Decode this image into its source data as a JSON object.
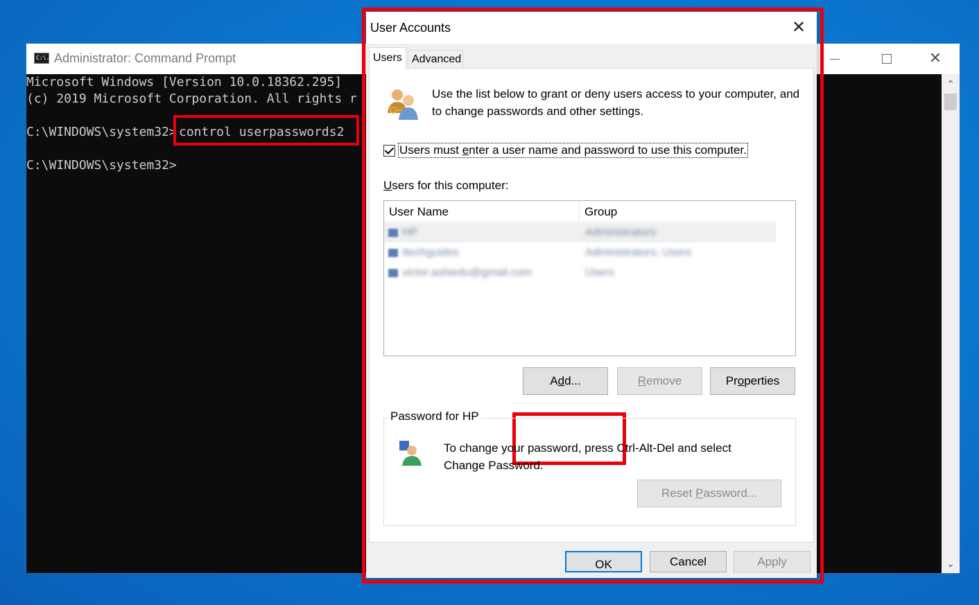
{
  "cmd": {
    "title": "Administrator: Command Prompt",
    "icon_text": "C:\\.",
    "close_glyph": "✕",
    "lines": [
      "Microsoft Windows [Version 10.0.18362.295]",
      "(c) 2019 Microsoft Corporation. All rights r",
      "",
      "C:\\WINDOWS\\system32>",
      "",
      "C:\\WINDOWS\\system32>"
    ],
    "command": "control userpasswords2",
    "scroll_up_glyph": "⌃",
    "scroll_down_glyph": "⌄"
  },
  "dialog": {
    "title": "User Accounts",
    "close_glyph": "✕",
    "tabs": [
      "Users",
      "Advanced"
    ],
    "intro": "Use the list below to grant or deny users access to your computer, and to change passwords and other settings.",
    "checkbox_label_pre": "Users must ",
    "checkbox_label_key": "e",
    "checkbox_label_post": "nter a user name and password to use this computer.",
    "checkbox_checked": true,
    "list_label_key": "U",
    "list_label_rest": "sers for this computer:",
    "columns": [
      "User Name",
      "Group"
    ],
    "rows": [
      {
        "name": "HP",
        "group": "Administrators"
      },
      {
        "name": "Itechguides",
        "group": "Administrators; Users"
      },
      {
        "name": "victor.ashiedu@gmail.com",
        "group": "Users"
      }
    ],
    "buttons": {
      "add_pre": "A",
      "add_key": "d",
      "add_post": "d...",
      "remove_key": "R",
      "remove_post": "emove",
      "properties_pre": "Pr",
      "properties_key": "o",
      "properties_post": "perties"
    },
    "password_group_title": "Password for HP",
    "password_text": "To change your password, press Ctrl-Alt-Del and select Change Password.",
    "reset_pre": "Reset ",
    "reset_key": "P",
    "reset_post": "assword...",
    "footer": {
      "ok": "OK",
      "cancel": "Cancel",
      "apply": "Apply"
    },
    "highlight_color": "#e8000d"
  }
}
